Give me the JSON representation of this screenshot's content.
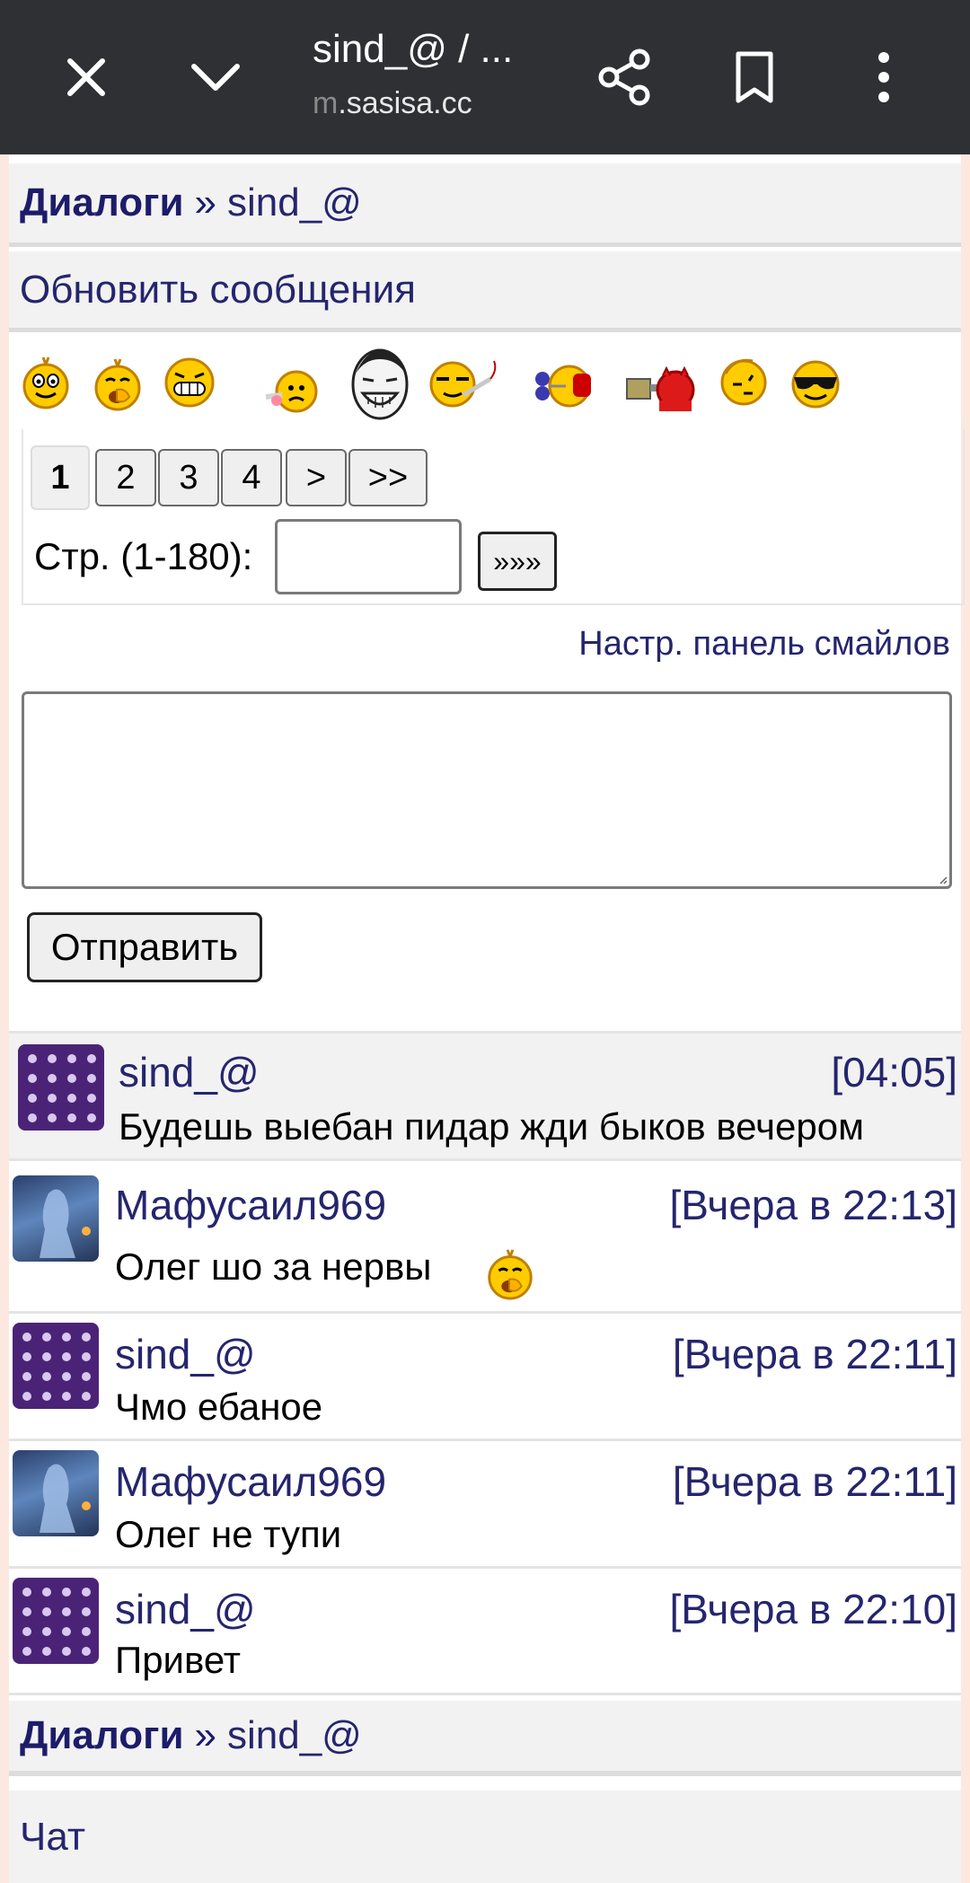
{
  "browser": {
    "title": "sind_@ / ...",
    "url_prefix": "m",
    "url_domain": ".sasisa.cc",
    "icons": [
      "close-icon",
      "chevron-down-icon",
      "share-icon",
      "bookmark-icon",
      "more-vert-icon"
    ]
  },
  "breadcrumb": {
    "root": "Диалоги",
    "separator": "»",
    "current": "sind_@"
  },
  "refresh_link": "Обновить сообщения",
  "smiles": [
    "smile-happy",
    "smile-yawn",
    "smile-grin",
    "smile-sad",
    "smile-troll",
    "smile-cigar",
    "smile-headphones",
    "smile-devil",
    "smile-thinking",
    "smile-sunglasses"
  ],
  "pager": {
    "pages": [
      "1",
      "2",
      "3",
      "4",
      ">",
      ">>"
    ],
    "current": "1",
    "goto_label": "Стр. (1-180):",
    "goto_button": "»»»"
  },
  "smile_settings_link": "Настр. панель смайлов",
  "send_button": "Отправить",
  "messages": [
    {
      "author": "sind_@",
      "time": "[04:05]",
      "text": "Будешь выебан пидар жди быков вечером",
      "avatar": "purple-pattern"
    },
    {
      "author": "Мафусаил969",
      "time": "[Вчера в 22:13]",
      "text": "Олег шо за нервы",
      "avatar": "blue-figure"
    },
    {
      "author": "sind_@",
      "time": "[Вчера в 22:11]",
      "text": "Чмо ебаное",
      "avatar": "purple-pattern"
    },
    {
      "author": "Мафусаил969",
      "time": "[Вчера в 22:11]",
      "text": "Олег не тупи",
      "avatar": "blue-figure"
    },
    {
      "author": "sind_@",
      "time": "[Вчера в 22:10]",
      "text": "Привет",
      "avatar": "purple-pattern"
    }
  ],
  "footer_breadcrumb": {
    "root": "Диалоги",
    "separator": "»",
    "current": "sind_@"
  },
  "chat_link": "Чат"
}
